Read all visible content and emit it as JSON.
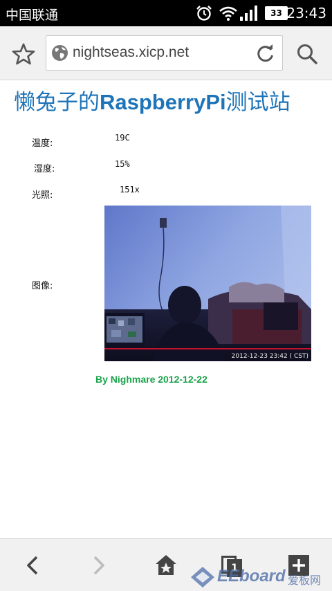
{
  "status_bar": {
    "carrier": "中国联通",
    "battery": "33",
    "time": "23:43",
    "icons": [
      "alarm-icon",
      "wifi-icon",
      "signal-icon",
      "battery-icon"
    ]
  },
  "browser": {
    "url": "nightseas.xicp.net",
    "icons": [
      "star-icon",
      "globe-icon",
      "reload-icon",
      "search-icon"
    ]
  },
  "page": {
    "title_prefix": "懒兔子的",
    "title_bold": "RaspberryPi",
    "title_suffix": "测试站",
    "readings": [
      {
        "label": "温度:",
        "value": "19C"
      },
      {
        "label": "湿度:",
        "value": "15%"
      },
      {
        "label": "光照:",
        "value": "151x"
      }
    ],
    "image_label": "图像:",
    "camera_timestamp": "2012-12-23 23:42 ( CST)",
    "footer": "By Nighmare 2012-12-22"
  },
  "navbar": {
    "tab_count": "1",
    "icons": [
      "back-icon",
      "forward-icon",
      "home-icon",
      "tabs-icon",
      "new-tab-icon"
    ]
  },
  "watermark": {
    "brand": "EEboard",
    "cn": "爱板网"
  },
  "colors": {
    "title": "#1e74b8",
    "footer": "#1aa34a",
    "chrome_bg": "#f1f1f1"
  }
}
